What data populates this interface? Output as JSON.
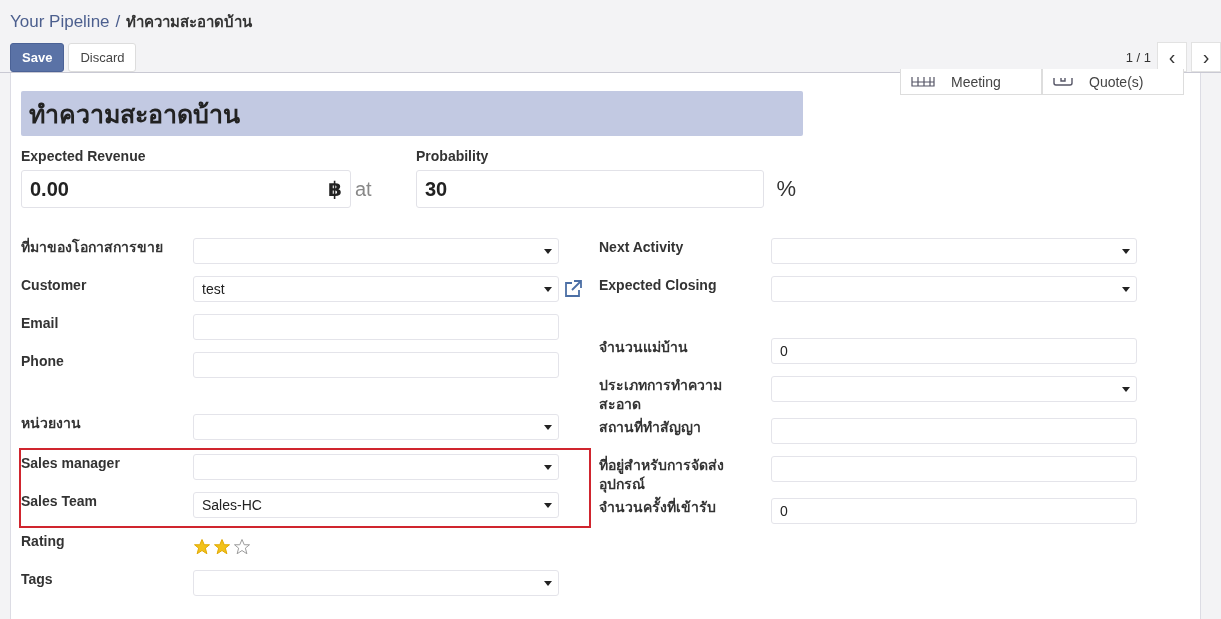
{
  "breadcrumb": {
    "parent": "Your Pipeline",
    "separator": "/",
    "current": "ทำความสะอาดบ้าน"
  },
  "buttons": [
    {
      "label": "Save",
      "kind": "primary"
    },
    {
      "label": "Discard",
      "kind": "secondary"
    }
  ],
  "pager": {
    "text": "1 / 1",
    "prev": "‹",
    "next": "›"
  },
  "smart_buttons": [
    {
      "label": "Meeting",
      "kind": "calendar"
    },
    {
      "label": "Quote(s)",
      "kind": "quote"
    }
  ],
  "title": "ทำความสะอาดบ้าน",
  "revenue": {
    "label": "Expected Revenue",
    "value": "0.00",
    "currency": "฿",
    "at": "at"
  },
  "probability": {
    "label": "Probability",
    "value": "30",
    "unit": "%"
  },
  "left_column": [
    {
      "blocks": [
        {
          "highlighted": false,
          "fields": [
            {
              "label": "ที่มาของโอกาสการขาย",
              "kind": "select"
            },
            {
              "label": "Customer",
              "kind": "select",
              "value": "test",
              "link": true
            },
            {
              "label": "Email",
              "kind": "input"
            },
            {
              "label": "Phone",
              "kind": "input"
            }
          ]
        }
      ]
    },
    {
      "blocks": [
        {
          "highlighted": false,
          "fields": [
            {
              "label": "หน่วยงาน",
              "kind": "select"
            }
          ]
        },
        {
          "highlighted": true,
          "fields": [
            {
              "label": "Sales manager",
              "kind": "select"
            },
            {
              "label": "Sales Team",
              "kind": "select",
              "value": "Sales-HC"
            }
          ]
        },
        {
          "highlighted": false,
          "fields": [
            {
              "label": "Rating",
              "kind": "stars",
              "stars": 2
            },
            {
              "label": "Tags",
              "kind": "select"
            }
          ]
        }
      ]
    }
  ],
  "right_column": [
    {
      "blocks": [
        {
          "highlighted": false,
          "fields": [
            {
              "label": "Next Activity",
              "kind": "select"
            },
            {
              "label": "Expected Closing",
              "kind": "select"
            }
          ]
        }
      ]
    },
    {
      "blocks": [
        {
          "highlighted": false,
          "fields": [
            {
              "label": "จำนวนแม่บ้าน",
              "kind": "input",
              "value": "0"
            },
            {
              "label": "ประเภทการทำความสะอาด",
              "kind": "select"
            },
            {
              "label": "สถานที่ทำสัญญา",
              "kind": "input"
            },
            {
              "label": "ที่อยู่สำหรับการจัดส่งอุปกรณ์",
              "kind": "input"
            },
            {
              "label": "จำนวนครั้งที่เข้ารับ",
              "kind": "input",
              "value": "0"
            }
          ]
        }
      ]
    }
  ]
}
